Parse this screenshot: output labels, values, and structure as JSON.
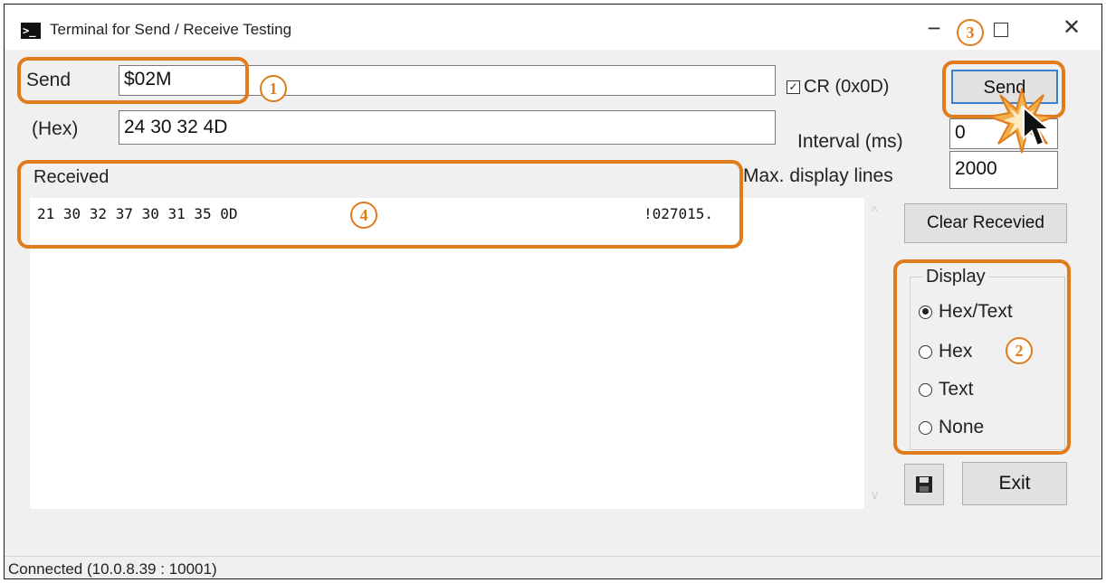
{
  "window": {
    "title": "Terminal for Send / Receive Testing",
    "icon": "terminal-icon",
    "controls": [
      "minimize-icon",
      "maximize-icon",
      "close-icon"
    ]
  },
  "send": {
    "label": "Send",
    "value": "$02M",
    "cr_label": "CR (0x0D)",
    "cr_checked": true,
    "button_label": "Send"
  },
  "hex": {
    "label": "(Hex)",
    "value": "24 30 32 4D"
  },
  "interval": {
    "label": "Interval (ms)",
    "value": "0"
  },
  "max_lines": {
    "label": "Max. display lines",
    "value": "2000"
  },
  "received": {
    "label": "Received",
    "hex": "21 30 32 37 30 31 35 0D",
    "text": "!027015."
  },
  "clear_button": "Clear Recevied",
  "display": {
    "title": "Display",
    "options": [
      "Hex/Text",
      "Hex",
      "Text",
      "None"
    ],
    "selected": "Hex/Text"
  },
  "exit_button": "Exit",
  "save_icon": "floppy-disk-icon",
  "annotations": [
    "1",
    "2",
    "3",
    "4"
  ],
  "accent_color": "#e07c1c",
  "status": "Connected (10.0.8.39 : 10001)"
}
